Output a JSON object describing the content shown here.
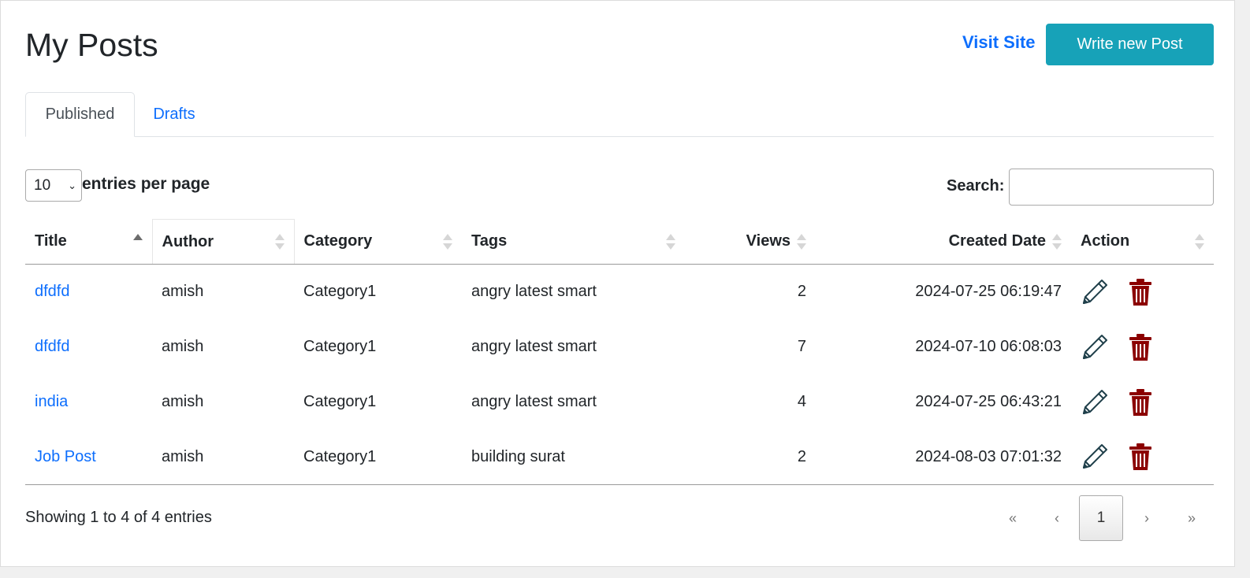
{
  "header": {
    "title": "My Posts",
    "visit_site": "Visit Site",
    "write_new": "Write new Post"
  },
  "tabs": [
    {
      "label": "Published",
      "active": true
    },
    {
      "label": "Drafts",
      "active": false
    }
  ],
  "controls": {
    "entries_value": "10",
    "entries_label": "entries per page",
    "search_label": "Search:",
    "search_value": ""
  },
  "table": {
    "columns": [
      "Title",
      "Author",
      "Category",
      "Tags",
      "Views",
      "Created Date",
      "Action"
    ],
    "sorted_column": "Title",
    "sort_direction": "asc",
    "rows": [
      {
        "title": "dfdfd",
        "author": "amish",
        "category": "Category1",
        "tags": "angry latest smart",
        "views": "2",
        "created": "2024-07-25 06:19:47"
      },
      {
        "title": "dfdfd",
        "author": "amish",
        "category": "Category1",
        "tags": "angry latest smart",
        "views": "7",
        "created": "2024-07-10 06:08:03"
      },
      {
        "title": "india",
        "author": "amish",
        "category": "Category1",
        "tags": "angry latest smart",
        "views": "4",
        "created": "2024-07-25 06:43:21"
      },
      {
        "title": "Job Post",
        "author": "amish",
        "category": "Category1",
        "tags": "building surat",
        "views": "2",
        "created": "2024-08-03 07:01:32"
      }
    ],
    "action_icons": [
      "pencil-icon",
      "trash-icon"
    ]
  },
  "footer": {
    "info": "Showing 1 to 4 of 4 entries",
    "pager": {
      "first": "«",
      "prev": "‹",
      "current": "1",
      "next": "›",
      "last": "»"
    }
  },
  "colors": {
    "link": "#0d6efd",
    "button": "#17a2b8",
    "edit_icon": "#1f3f4a",
    "delete_icon": "#8b0000"
  }
}
